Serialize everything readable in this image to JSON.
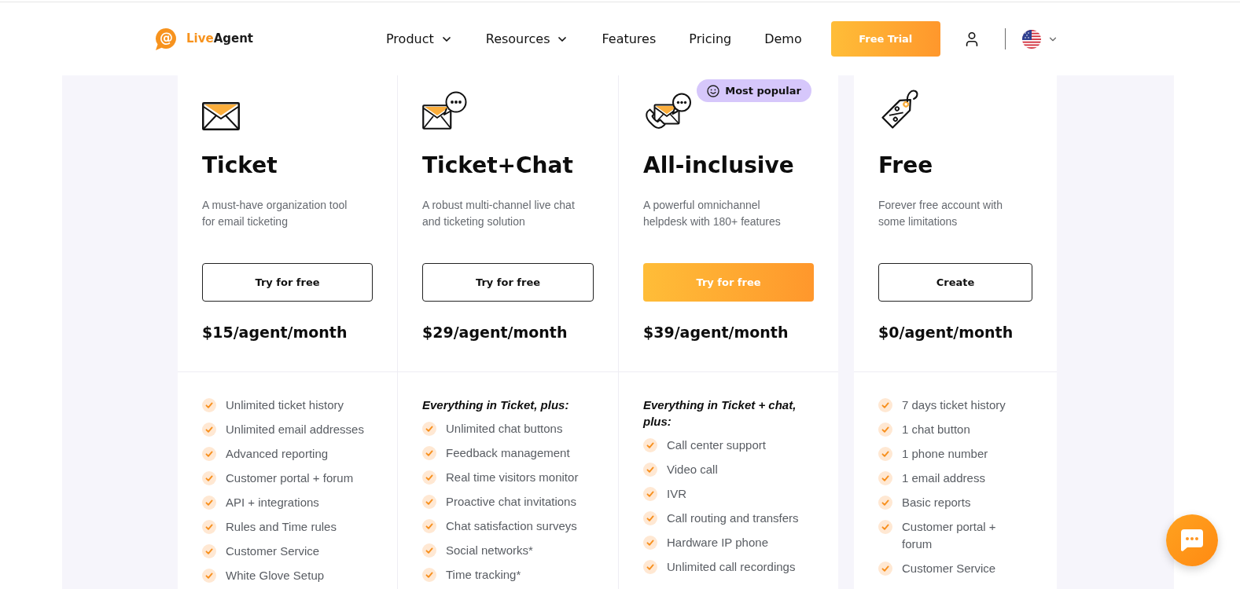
{
  "header": {
    "logo": {
      "mark": "@",
      "first": "Live",
      "second": "Agent"
    },
    "nav": [
      {
        "label": "Product",
        "has_menu": true
      },
      {
        "label": "Resources",
        "has_menu": true
      },
      {
        "label": "Features",
        "has_menu": false
      },
      {
        "label": "Pricing",
        "has_menu": false
      },
      {
        "label": "Demo",
        "has_menu": false
      }
    ],
    "cta": "Free Trial"
  },
  "plans": [
    {
      "title": "Ticket",
      "description": [
        "A must-have organization tool",
        "for email ticketing"
      ],
      "button": {
        "label": "Try for free",
        "highlighted": false
      },
      "price": "$15/agent/month",
      "features": [
        "Unlimited ticket history",
        "Unlimited email addresses",
        "Advanced reporting",
        "Customer portal + forum",
        "API + integrations",
        "Rules and Time rules",
        "Customer Service",
        "White Glove Setup"
      ]
    },
    {
      "title": "Ticket+Chat",
      "description": [
        "A robust multi-channel live chat",
        "and ticketing solution"
      ],
      "button": {
        "label": "Try for free",
        "highlighted": false
      },
      "price": "$29/agent/month",
      "features_heading": "Everything in Ticket, plus:",
      "features": [
        "Unlimited chat buttons",
        "Feedback management",
        "Real time visitors monitor",
        "Proactive chat invitations",
        "Chat satisfaction surveys",
        "Social networks*",
        "Time tracking*"
      ]
    },
    {
      "badge": "Most popular",
      "title": "All-inclusive",
      "description": [
        "A powerful omnichannel",
        "helpdesk with 180+ features"
      ],
      "button": {
        "label": "Try for free",
        "highlighted": true
      },
      "price": "$39/agent/month",
      "features_heading": "Everything in Ticket + chat, plus:",
      "features": [
        "Call center support",
        "Video call",
        "IVR",
        "Call routing and transfers",
        "Hardware IP phone",
        "Unlimited call recordings"
      ]
    },
    {
      "title": "Free",
      "description": [
        "Forever free account with",
        "some limitations"
      ],
      "button": {
        "label": "Create",
        "highlighted": false
      },
      "price": "$0/agent/month",
      "features": [
        "7 days ticket history",
        "1 chat button",
        "1 phone number",
        "1 email address",
        "Basic reports",
        "Customer portal + forum",
        "Customer Service"
      ]
    }
  ]
}
